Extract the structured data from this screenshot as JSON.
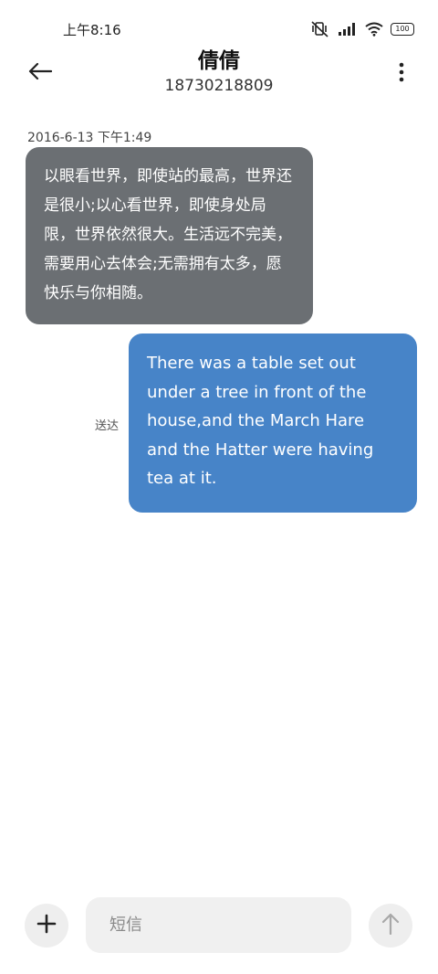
{
  "status_bar": {
    "time": "上午8:16",
    "battery": "100",
    "icons": [
      "mute-vibrate-icon",
      "signal-icon",
      "wifi-icon",
      "battery-icon"
    ]
  },
  "header": {
    "contact_name": "倩倩",
    "contact_number": "18730218809",
    "icons": [
      "back-arrow-icon",
      "more-vertical-icon"
    ]
  },
  "conversation": {
    "timestamp": "2016-6-13 下午1:49",
    "messages": [
      {
        "direction": "incoming",
        "text": "以眼看世界，即使站的最高，世界还是很小;以心看世界，即使身处局限，世界依然很大。生活远不完美，需要用心去体会;无需拥有太多，愿快乐与你相随。"
      },
      {
        "direction": "outgoing",
        "text": "There was a table set out under a tree in front of the house,and the March Hare and the Hatter were having tea at it.",
        "status": "送达"
      }
    ]
  },
  "composer": {
    "placeholder": "短信",
    "value": "",
    "icons": [
      "plus-icon",
      "send-arrow-icon"
    ]
  },
  "colors": {
    "incoming_bubble": "#6b6f73",
    "outgoing_bubble": "#4784c8",
    "background": "#ffffff"
  }
}
